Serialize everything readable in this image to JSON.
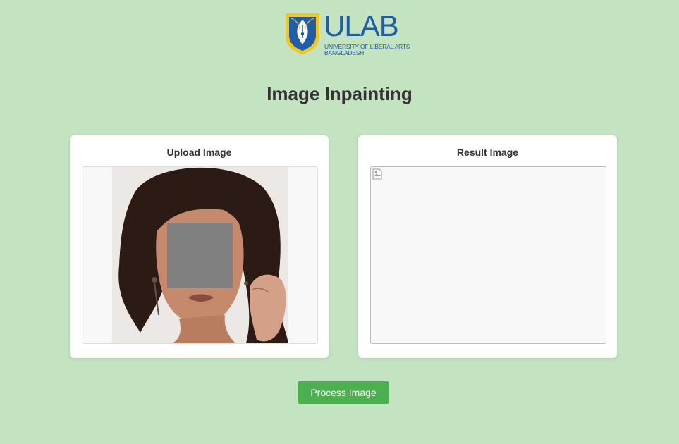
{
  "brand": {
    "logo_text": "ULAB",
    "subline_1": "UNIVERSITY OF LIBERAL ARTS",
    "subline_2": "BANGLADESH",
    "icon": "pen-nib-shield-logo"
  },
  "page": {
    "title": "Image Inpainting"
  },
  "upload_panel": {
    "title": "Upload Image",
    "image_icon": "uploaded-photo-with-gray-mask"
  },
  "result_panel": {
    "title": "Result Image",
    "image_icon": "broken-image-icon"
  },
  "actions": {
    "process_label": "Process Image"
  },
  "colors": {
    "background": "#c3e3c1",
    "card": "#ffffff",
    "accent_button": "#4caf50",
    "logo_blue": "#1f5ea8",
    "logo_yellow": "#f5c518",
    "mask_gray": "#808080",
    "title_text": "#333333"
  }
}
